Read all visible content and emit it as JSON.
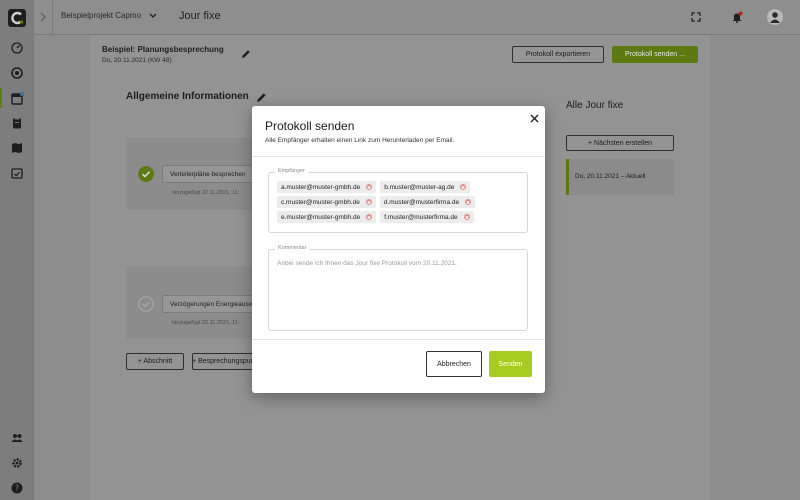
{
  "colors": {
    "accent": "#a6cc22",
    "accent_dimmed": "#5d7a12",
    "overlay_background": "#8d8d8d",
    "modal_background": "#ffffff",
    "chip_remove": "#e08a8a"
  },
  "topbar": {
    "project": "Beispielprojekt Capmo",
    "page_title": "Jour fixe",
    "icons": [
      "chevron-right-icon",
      "chevron-down-icon",
      "fullscreen-icon",
      "notification-bell-icon",
      "user-avatar"
    ]
  },
  "sidebar": {
    "icons": [
      "capmo-logo",
      "dashboard-icon",
      "tickets-icon",
      "calendar-icon",
      "clipboard-icon",
      "map-icon",
      "calendar-check-icon",
      "team-icon",
      "settings-icon",
      "help-icon"
    ]
  },
  "meeting": {
    "title": "Beispiel: Planungsbesprechung",
    "date": "Do, 20.11.2021 (KW 48)",
    "export_label": "Protokoll exportieren",
    "send_label": "Protokoll senden ..."
  },
  "general": {
    "title": "Allgemeine Informationen",
    "items": [
      {
        "text": "Verteilerpläne besprechen",
        "meta": "hinzugefügt 22.11.2021, 11:",
        "done": true
      },
      {
        "text": "Verzögerungen Energieausweis",
        "meta": "hinzugefügt 22.11.2021, 11:",
        "done": false
      }
    ],
    "add_section_label": "+ Abschnitt",
    "add_discussion_label": "+ Besprechungspunkt"
  },
  "jourfixe_list": {
    "title": "Alle Jour fixe",
    "create_next_label": "+ Nächsten erstellen",
    "entries": [
      {
        "label": "Do, 20.11.2021 – Aktuell"
      }
    ]
  },
  "modal": {
    "title": "Protokoll senden",
    "subtitle": "Alle Empfänger erhalten einen Link zum Herunterladen per Email.",
    "recipients_label": "Empfänger",
    "recipients": [
      "a.muster@muster-gmbh.de",
      "b.muster@muster-ag.de",
      "c.muster@muster-gmbh.de",
      "d.muster@musterfirma.de",
      "e.muster@muster-gmbh.de",
      "f.muster@musterfirma.de"
    ],
    "comment_label": "Kommentar",
    "comment_placeholder": "Anbei sende ich Ihnen das Jour fixe Protokoll vom 20.11.2021.",
    "cancel_label": "Abbrechen",
    "submit_label": "Senden"
  }
}
